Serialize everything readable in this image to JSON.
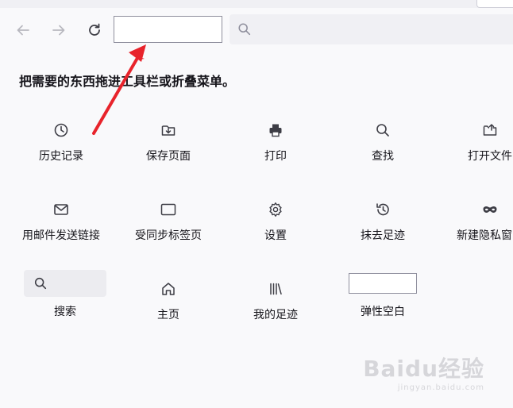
{
  "toolbar": {
    "back_icon": "back-arrow-icon",
    "forward_icon": "forward-arrow-icon",
    "reload_icon": "reload-icon",
    "urlbar_icon": "search-icon"
  },
  "palette": {
    "heading": "把需要的东西拖进工具栏或折叠菜单。",
    "items": [
      {
        "label": "历史记录",
        "icon": "clock-icon"
      },
      {
        "label": "保存页面",
        "icon": "save-page-icon"
      },
      {
        "label": "打印",
        "icon": "printer-icon"
      },
      {
        "label": "查找",
        "icon": "search-icon"
      },
      {
        "label": "打开文件",
        "icon": "open-file-icon"
      },
      {
        "label": "用邮件发送链接",
        "icon": "mail-icon"
      },
      {
        "label": "受同步标签页",
        "icon": "synced-tabs-icon"
      },
      {
        "label": "设置",
        "icon": "gear-icon"
      },
      {
        "label": "抹去足迹",
        "icon": "forget-history-icon"
      },
      {
        "label": "新建隐私窗口",
        "icon": "private-mask-icon"
      },
      {
        "label": "搜索",
        "icon": "search-icon"
      },
      {
        "label": "主页",
        "icon": "home-icon"
      },
      {
        "label": "我的足迹",
        "icon": "library-icon"
      },
      {
        "label": "弹性空白",
        "icon": "flexible-space-box"
      }
    ]
  },
  "colors": {
    "annotation_arrow": "#e8232b",
    "background": "#f9f9fb",
    "text": "#15141a"
  },
  "watermark": {
    "main": "Baidu经验",
    "sub": "jingyan.baidu.com"
  }
}
